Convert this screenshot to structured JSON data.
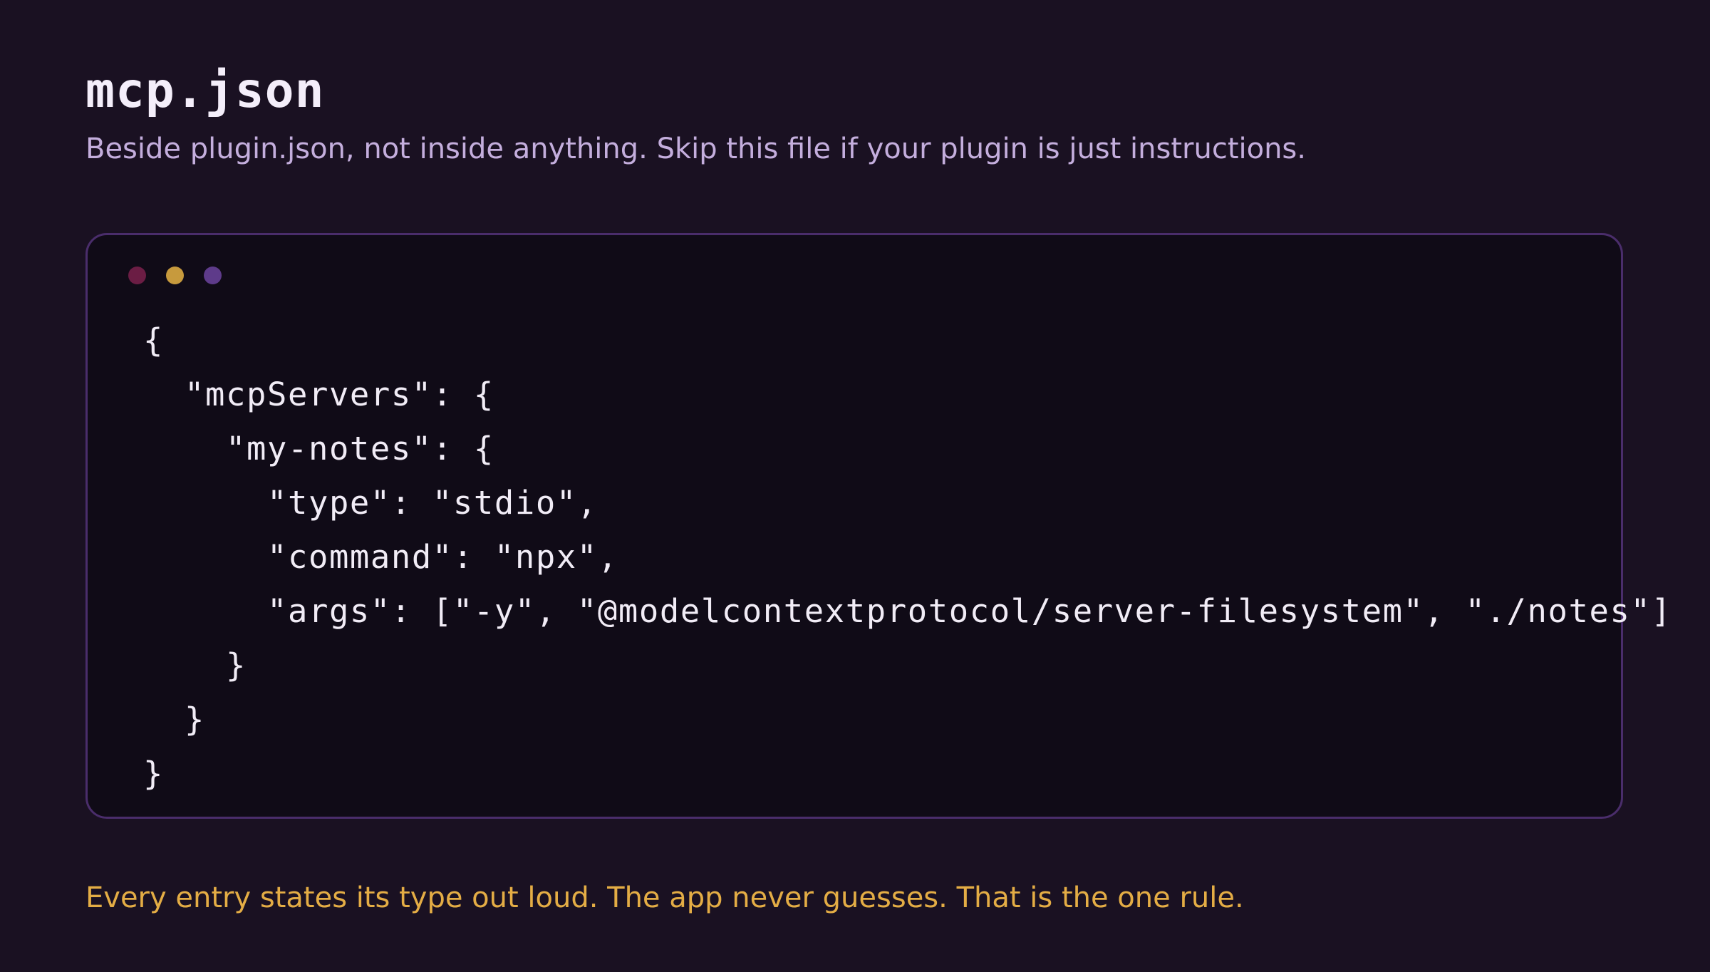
{
  "title": "mcp.json",
  "subtitle": "Beside plugin.json, not inside anything. Skip this file if your plugin is just instructions.",
  "code_window": {
    "lines": [
      "{",
      "  \"mcpServers\": {",
      "    \"my-notes\": {",
      "      \"type\": \"stdio\",",
      "      \"command\": \"npx\",",
      "      \"args\": [\"-y\", \"@modelcontextprotocol/server-filesystem\", \"./notes\"]",
      "    }",
      "  }",
      "}"
    ],
    "dots": [
      "#6b1d44",
      "#c79a3d",
      "#5e3b8a"
    ]
  },
  "footnote": "Every entry states its type out loud. The app never guesses. That is the one rule.",
  "colors": {
    "background": "#1a1122",
    "code_background": "#100b17",
    "border": "#4a2d6b",
    "subtitle": "#c4aedd",
    "footnote": "#e4ad45"
  }
}
